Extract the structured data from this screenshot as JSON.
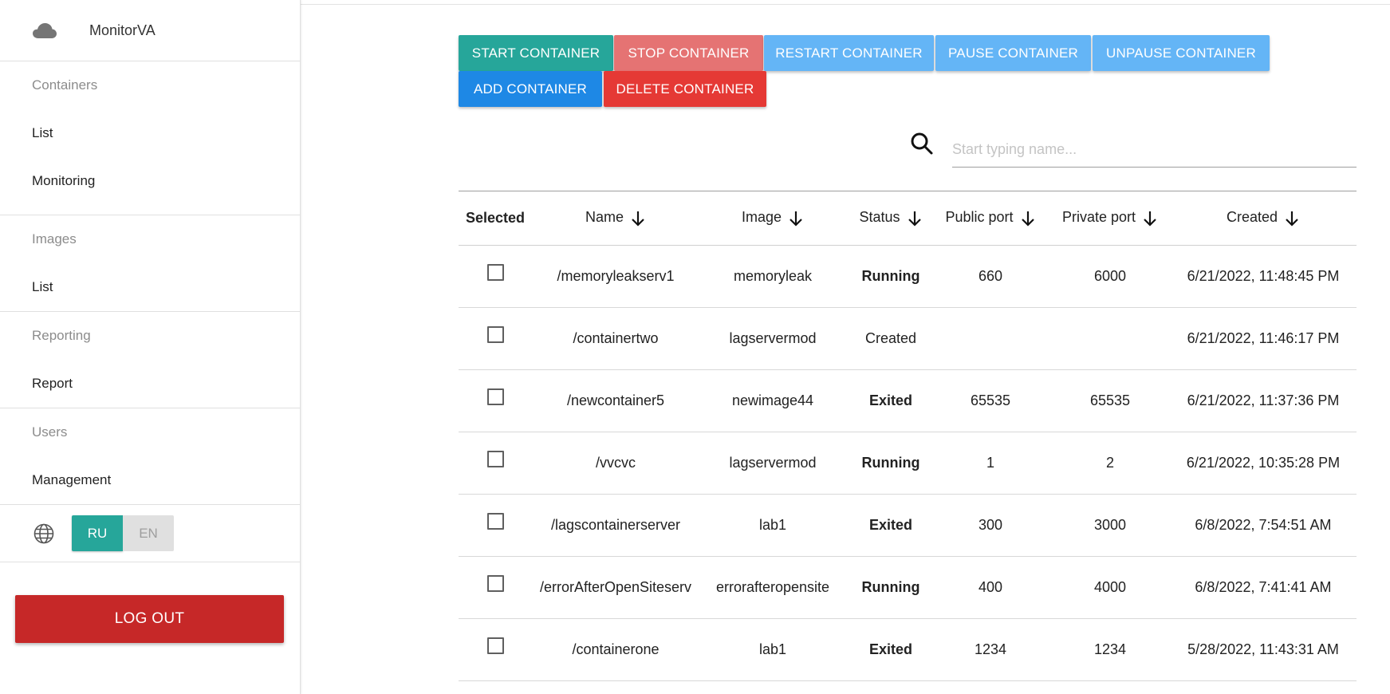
{
  "sidebar": {
    "brand": {
      "icon": "cloud-icon",
      "name": "MonitorVA"
    },
    "sections": [
      {
        "title": "Containers",
        "items": [
          "List",
          "Monitoring"
        ]
      },
      {
        "title": "Images",
        "items": [
          "List"
        ]
      },
      {
        "title": "Reporting",
        "items": [
          "Report"
        ]
      },
      {
        "title": "Users",
        "items": [
          "Management"
        ]
      }
    ],
    "lang": {
      "icon": "globe-icon",
      "active": "RU",
      "inactive": "EN"
    },
    "logout_label": "LOG OUT"
  },
  "toolbar": {
    "start": "START CONTAINER",
    "stop": "STOP CONTAINER",
    "restart": "RESTART CONTAINER",
    "pause": "PAUSE CONTAINER",
    "unpause": "UNPAUSE CONTAINER",
    "add": "ADD CONTAINER",
    "delete": "DELETE CONTAINER"
  },
  "search": {
    "icon": "search-icon",
    "placeholder": "Start typing name..."
  },
  "table": {
    "headers": {
      "selected": "Selected",
      "name": "Name",
      "image": "Image",
      "status": "Status",
      "public_port": "Public port",
      "private_port": "Private port",
      "created": "Created"
    },
    "rows": [
      {
        "name": "/memoryleakserv1",
        "image": "memoryleak",
        "status": "Running",
        "public_port": "660",
        "private_port": "6000",
        "created": "6/21/2022, 11:48:45 PM"
      },
      {
        "name": "/containertwo",
        "image": "lagservermod",
        "status": "Created",
        "public_port": "",
        "private_port": "",
        "created": "6/21/2022, 11:46:17 PM"
      },
      {
        "name": "/newcontainer5",
        "image": "newimage44",
        "status": "Exited",
        "public_port": "65535",
        "private_port": "65535",
        "created": "6/21/2022, 11:37:36 PM"
      },
      {
        "name": "/vvcvc",
        "image": "lagservermod",
        "status": "Running",
        "public_port": "1",
        "private_port": "2",
        "created": "6/21/2022, 10:35:28 PM"
      },
      {
        "name": "/lagscontainerserver",
        "image": "lab1",
        "status": "Exited",
        "public_port": "300",
        "private_port": "3000",
        "created": "6/8/2022, 7:54:51 AM"
      },
      {
        "name": "/errorAfterOpenSiteserv",
        "image": "errorafteropensite",
        "status": "Running",
        "public_port": "400",
        "private_port": "4000",
        "created": "6/8/2022, 7:41:41 AM"
      },
      {
        "name": "/containerone",
        "image": "lab1",
        "status": "Exited",
        "public_port": "1234",
        "private_port": "1234",
        "created": "5/28/2022, 11:43:31 AM"
      }
    ]
  },
  "colors": {
    "teal": "#26a69a",
    "stop_red_light": "#e57373",
    "light_blue": "#64b5f6",
    "blue": "#1e88e5",
    "delete_red": "#e53935",
    "logout_red": "#c62828",
    "running_green": "#1b8a1b",
    "exited_red": "#e31b1b"
  }
}
